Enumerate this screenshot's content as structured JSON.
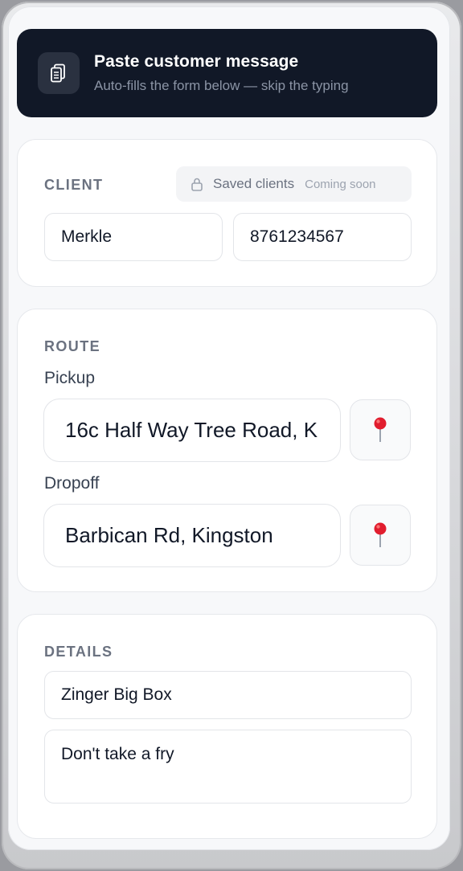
{
  "paste": {
    "title": "Paste customer message",
    "subtitle": "Auto-fills the form below — skip the typing",
    "icon": "clipboard-icon"
  },
  "client": {
    "section_label": "CLIENT",
    "saved_clients_label": "Saved clients",
    "saved_clients_badge": "Coming soon",
    "name_value": "Merkle",
    "phone_value": "8761234567"
  },
  "route": {
    "section_label": "ROUTE",
    "pickup_label": "Pickup",
    "pickup_value": "16c Half Way Tree Road, K",
    "dropoff_label": "Dropoff",
    "dropoff_value": "Barbican Rd, Kingston",
    "pin_icon": "map-pin-icon"
  },
  "details": {
    "section_label": "DETAILS",
    "item_value": "Zinger Big Box",
    "notes_value": "Don't take a fry"
  },
  "colors": {
    "banner_bg": "#111827",
    "pin_red": "#e11d2e"
  }
}
